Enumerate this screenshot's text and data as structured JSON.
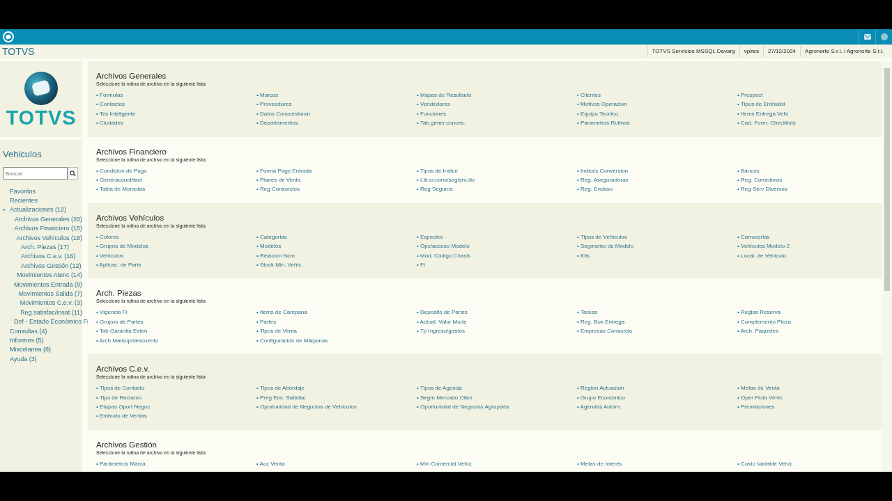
{
  "header": {
    "title": "TOTVS",
    "info": [
      "TOTVS Servicios MSSQL Devarg",
      "vpires",
      "27/12/2024",
      "Agronorte S.r.l. / Agronorte S.r.l."
    ]
  },
  "sidebar": {
    "logo_text": "TOTVS",
    "module": "Vehiculos",
    "search": {
      "placeholder": "Buscar"
    },
    "tree": [
      {
        "label": "Favoritos"
      },
      {
        "label": "Recientes"
      },
      {
        "label": "Actualizaciones (12)",
        "expanded": true,
        "children": [
          {
            "label": "Archivos Generales (20)"
          },
          {
            "label": "Archivos Financiero (15)"
          },
          {
            "label": "Archivos Vehículos (18)"
          },
          {
            "label": "Arch. Piezas (17)"
          },
          {
            "label": "Archivos C.e.v. (16)"
          },
          {
            "label": "Archivos Gestión (12)"
          },
          {
            "label": "Movimientos Atenc (14)"
          },
          {
            "label": "Movimientos Entrada (9)"
          },
          {
            "label": "Movimientos Salida (7)"
          },
          {
            "label": "Movimientos C.e.v. (3)"
          },
          {
            "label": "Reg.satisfac/insat (11)"
          },
          {
            "label": "Def - Estado Económico Fi"
          }
        ]
      },
      {
        "label": "Consultas (4)"
      },
      {
        "label": "Informes (5)"
      },
      {
        "label": "Miscelanea (8)"
      },
      {
        "label": "Ayuda (3)"
      }
    ]
  },
  "sections": [
    {
      "title": "Archivos Generales",
      "subtitle": "Seleccione la rutina de archivo en la siguiente lista",
      "items": [
        "• Formulas",
        "• Marcas",
        "• Mapas de Resultado",
        "• Clientes",
        "• Prospect",
        "• Contactos",
        "• Proveedores",
        "• Vendedores",
        "• Motivos Operacion",
        "• Tipos de Ent/salid",
        "• Tes Inteligente",
        "• Datos Conccesionar",
        "• Funciones",
        "• Equipo Tecnico",
        "• Items Entrega Vehi",
        "• Ciudades",
        "• Departamentos",
        "• Tab.gener.conces.",
        "• Parametros Rutinas",
        "• Cad. Form. Checklists"
      ]
    },
    {
      "title": "Archivos Financiero",
      "subtitle": "Seleccione la rutina de archivo en la siguiente lista",
      "items": [
        "• Condicion de Pago",
        "• Forma Pago Entrada",
        "• Tipos de Indice",
        "• Indices Conversion",
        "• Bancos",
        "• Generaccuot/fact",
        "• Planes de Venta",
        "• Lib.cr.cons/seg/srv.div.",
        "• Reg. Aseguradoras",
        "• Reg. Corredoras",
        "• Tabla de Monedas",
        "• Reg Consorcios",
        "• Reg Seguros",
        "• Reg. Endoso",
        "• Reg Serv Diversos"
      ]
    },
    {
      "title": "Archivos Vehículos",
      "subtitle": "Seleccione la rutina de archivo en la siguiente lista",
      "items": [
        "• Colores",
        "• Categorias",
        "• Especies",
        "• Tipos de Vehiculos",
        "• Carrocerias",
        "• Grupos de Modelos",
        "• Modelos",
        "• Opc/acceso Modelo",
        "• Segmento de Modelo",
        "• Vehículos Modelo 2",
        "• Vehiculos",
        "• Relacion Ncm",
        "• Mod. Código Chasis",
        "• Kits",
        "• Local. de Vehiculo",
        "• Aplicac. de Parte",
        "• Stock Min. Vehic.",
        "• Fi"
      ]
    },
    {
      "title": "Arch. Piezas",
      "subtitle": "Seleccione la rutina de archivo en la siguiente lista",
      "items": [
        "• Vigencia Fi",
        "• Items de Campana",
        "• Deposito de Partes",
        "• Tareas",
        "• Reglas Reserva",
        "• Grupos de Partes",
        "• Partes",
        "• Actual. Valor Mode",
        "• Reg. Box Entrega",
        "• Complemento Pieza",
        "• Tab Garantia Exten",
        "• Tipos de Venta",
        "• Tp Ingreso/gastos",
        "• Empresas Consorcio",
        "• Arch. Paquetes",
        "• Arch Markup/descuento",
        "• Configuración de Máquinas"
      ]
    },
    {
      "title": "Archivos C.e.v.",
      "subtitle": "Seleccione la rutina de archivo en la siguiente lista",
      "items": [
        "• Tipos de Contacto",
        "• Tipos de Abordaje",
        "• Tipos de Agenda",
        "• Region Actuacion",
        "• Metas de Venta",
        "• Tipo de Reclamo",
        "• Preg Enc. Satisfac",
        "• Segm Mercado Clien",
        "• Grupo Económico",
        "• Oper Flota Vehíc",
        "• Etapas Oport Negoc",
        "• Oportunidad de Negocios de Vehículos",
        "• Oportunidad de Negocios Agrupada",
        "• Agendas Autom.",
        "• Premiaciones",
        "• Embudo de Ventas"
      ]
    },
    {
      "title": "Archivos Gestión",
      "subtitle": "Seleccione la rutina de archivo en la siguiente lista",
      "items": [
        "• Parâmetros Marca",
        "• Acc Venta",
        "• Mín Comercial Vehíc",
        "• Metas de Interés",
        "• Costo Variable Vehíc"
      ]
    }
  ]
}
